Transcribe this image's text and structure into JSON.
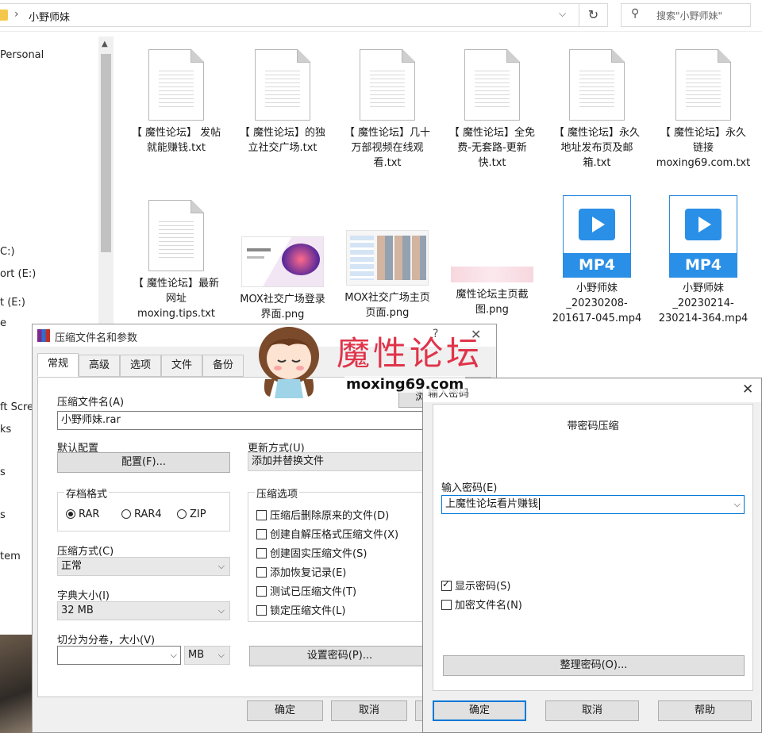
{
  "explorer": {
    "breadcrumb": "小野师妹",
    "search_placeholder": "搜索\"小野师妹\"",
    "nav_items": [
      "Personal",
      "C:)",
      "ort (E:)",
      "t (E:)",
      "e",
      "ft Scre",
      "ks",
      "s",
      "s",
      "tem"
    ],
    "files": [
      {
        "name": "【 魔性论坛】 发帖就能赚钱.txt",
        "type": "txt"
      },
      {
        "name": "【 魔性论坛】的独立社交广场.txt",
        "type": "txt"
      },
      {
        "name": "【 魔性论坛】几十万部视频在线观看.txt",
        "type": "txt"
      },
      {
        "name": "【 魔性论坛】全免费-无套路-更新快.txt",
        "type": "txt"
      },
      {
        "name": "【 魔性论坛】永久地址发布页及邮箱.txt",
        "type": "txt"
      },
      {
        "name": "【 魔性论坛】永久链接moxing69.com.txt",
        "type": "txt"
      },
      {
        "name": "【 魔性论坛】最新网址moxing.tips.txt",
        "type": "txt"
      },
      {
        "name": "MOX社交广场登录界面.png",
        "type": "png"
      },
      {
        "name": "MOX社交广场主页页面.png",
        "type": "png"
      },
      {
        "name": "魔性论坛主页截图.png",
        "type": "png"
      },
      {
        "name": "小野师妹_20230208-201617-045.mp4",
        "type": "mp4",
        "badge": "MP4"
      },
      {
        "name": "小野师妹_20230214-230214-364.mp4",
        "type": "mp4",
        "badge": "MP4"
      }
    ]
  },
  "rar_dialog": {
    "title": "压缩文件名和参数",
    "help_glyph": "?",
    "tabs": [
      "常规",
      "高级",
      "选项",
      "文件",
      "备份"
    ],
    "archive_name_label": "压缩文件名(A)",
    "archive_name_value": "小野师妹.rar",
    "browse_button": "浏览(B)...",
    "default_profile_label": "默认配置",
    "profile_button": "配置(F)...",
    "update_mode_label": "更新方式(U)",
    "update_mode_value": "添加并替换文件",
    "format_label": "存档格式",
    "formats": [
      "RAR",
      "RAR4",
      "ZIP"
    ],
    "selected_format": "RAR",
    "options_label": "压缩选项",
    "options": [
      {
        "label": "压缩后删除原来的文件(D)",
        "checked": false
      },
      {
        "label": "创建自解压格式压缩文件(X)",
        "checked": false
      },
      {
        "label": "创建固实压缩文件(S)",
        "checked": false
      },
      {
        "label": "添加恢复记录(E)",
        "checked": false
      },
      {
        "label": "测试已压缩文件(T)",
        "checked": false
      },
      {
        "label": "锁定压缩文件(L)",
        "checked": false
      }
    ],
    "method_label": "压缩方式(C)",
    "method_value": "正常",
    "dict_label": "字典大小(I)",
    "dict_value": "32 MB",
    "split_label": "切分为分卷，大小(V)",
    "split_value": "",
    "split_unit": "MB",
    "set_password_button": "设置密码(P)...",
    "ok_button": "确定",
    "cancel_button": "取消"
  },
  "pwd_dialog": {
    "title": "输入密码",
    "heading": "带密码压缩",
    "password_label": "输入密码(E)",
    "password_value": "上魔性论坛看片赚钱",
    "show_password_label": "显示密码(S)",
    "show_password_checked": true,
    "encrypt_names_label": "加密文件名(N)",
    "encrypt_names_checked": false,
    "organize_button": "整理密码(O)...",
    "ok_button": "确定",
    "cancel_button": "取消",
    "help_button": "帮助"
  },
  "watermark": {
    "title": "魔性论坛",
    "url": "moxing69.com"
  },
  "colors": {
    "accent": "#0078d7",
    "mp4_blue": "#2a8fe6",
    "watermark_red": "#e0344a"
  }
}
